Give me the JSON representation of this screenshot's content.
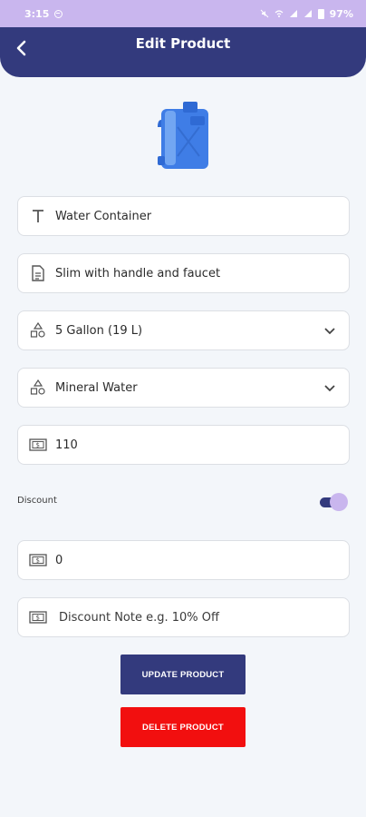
{
  "status_bar": {
    "time": "3:15",
    "battery": "97%"
  },
  "header": {
    "title": "Edit Product"
  },
  "product": {
    "image_icon": "water-container-image"
  },
  "form": {
    "name": {
      "value": "Water Container",
      "icon": "text-icon"
    },
    "description": {
      "value": "Slim with handle and faucet",
      "icon": "document-icon"
    },
    "size": {
      "value": "5 Gallon (19 L)",
      "icon": "shapes-icon"
    },
    "category": {
      "value": "Mineral Water",
      "icon": "shapes-icon"
    },
    "price": {
      "value": "110",
      "icon": "money-icon"
    },
    "discount_label": "Discount",
    "discount_enabled": true,
    "discount_amount": {
      "value": "0",
      "icon": "money-icon"
    },
    "discount_note": {
      "placeholder": "Discount Note e.g. 10% Off",
      "icon": "money-icon"
    }
  },
  "buttons": {
    "update": "UPDATE PRODUCT",
    "delete": "DELETE PRODUCT"
  },
  "colors": {
    "primary": "#333a7d",
    "accent": "#c9b6ee",
    "danger": "#f20f0f",
    "background": "#f3f6fa"
  }
}
